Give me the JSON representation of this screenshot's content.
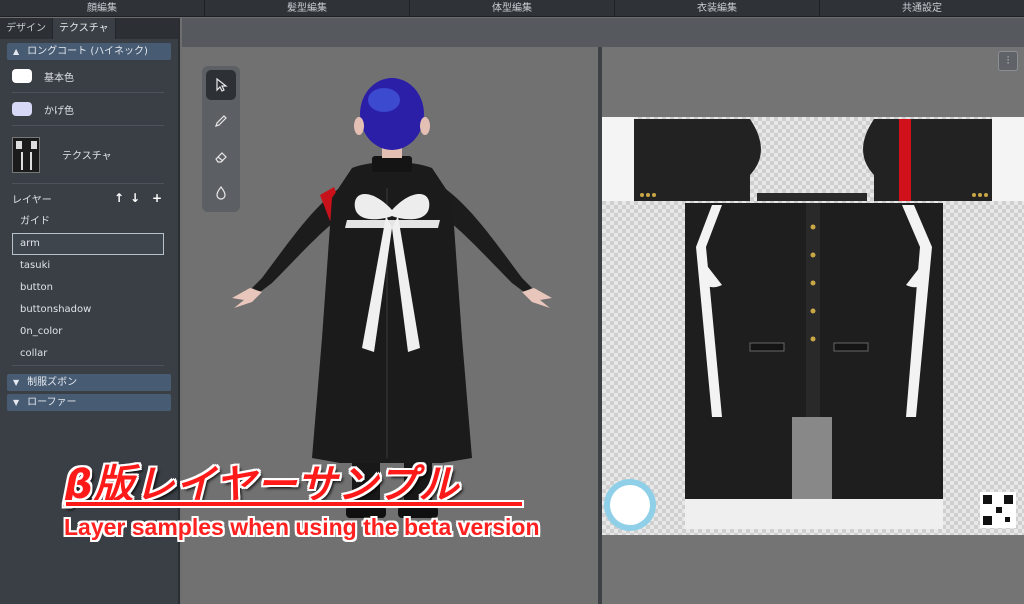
{
  "top_menu": [
    "顔編集",
    "髪型編集",
    "体型編集",
    "衣装編集",
    "共通設定"
  ],
  "tabs": [
    "デザイン",
    "テクスチャ"
  ],
  "panel": {
    "section_title": "ロングコート (ハイネック)",
    "base_color_label": "基本色",
    "shade_color_label": "かげ色",
    "texture_label": "テクスチャ",
    "layers_label": "レイヤー",
    "layers": [
      "ガイド",
      "arm",
      "tasuki",
      "button",
      "buttonshadow",
      "0n_color",
      "collar"
    ],
    "selected_layer": "arm",
    "section2_title": "制服ズボン",
    "section3_title": "ローファー"
  },
  "colors": {
    "base_swatch": "#ffffff",
    "shade_swatch": "#d6d8f5",
    "section_header": "#475b73",
    "overlay_red": "#ff1a1a"
  },
  "tools": [
    "cursor-icon",
    "pencil-icon",
    "eraser-icon",
    "dropper-icon"
  ],
  "overlay": {
    "title": "β版レイヤーサンプル",
    "subtitle": "Layer samples when using the beta version"
  }
}
